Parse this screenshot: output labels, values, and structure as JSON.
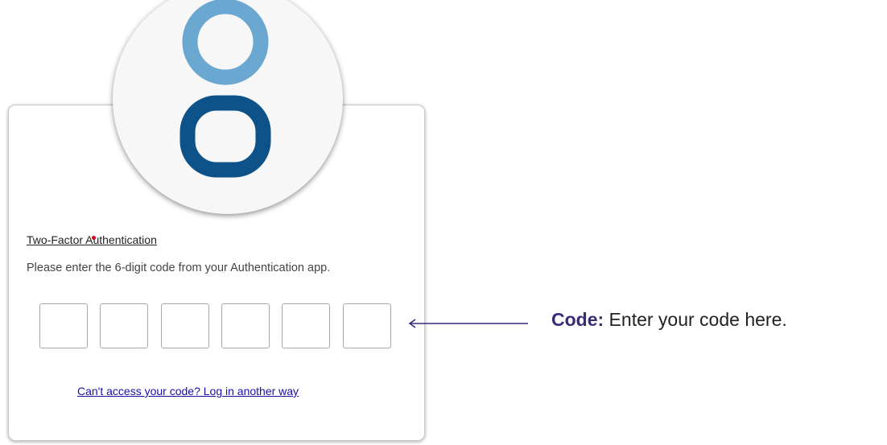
{
  "mfa": {
    "title": "Two-Factor Authentication",
    "instructions": "Please enter the 6-digit code from your Authentication app.",
    "code_digits": [
      "",
      "",
      "",
      "",
      "",
      ""
    ],
    "alt_link": "Can't access your code? Log in another way"
  },
  "callout": {
    "label": "Code:",
    "text": " Enter your code here."
  },
  "colors": {
    "logo_light": "#6aa8d2",
    "logo_dark": "#0d5288",
    "callout_label": "#3b2a78",
    "arrow": "#3b2a78"
  },
  "icons": {
    "logo": "brand-logo-icon",
    "arrow": "arrow-left-icon"
  }
}
